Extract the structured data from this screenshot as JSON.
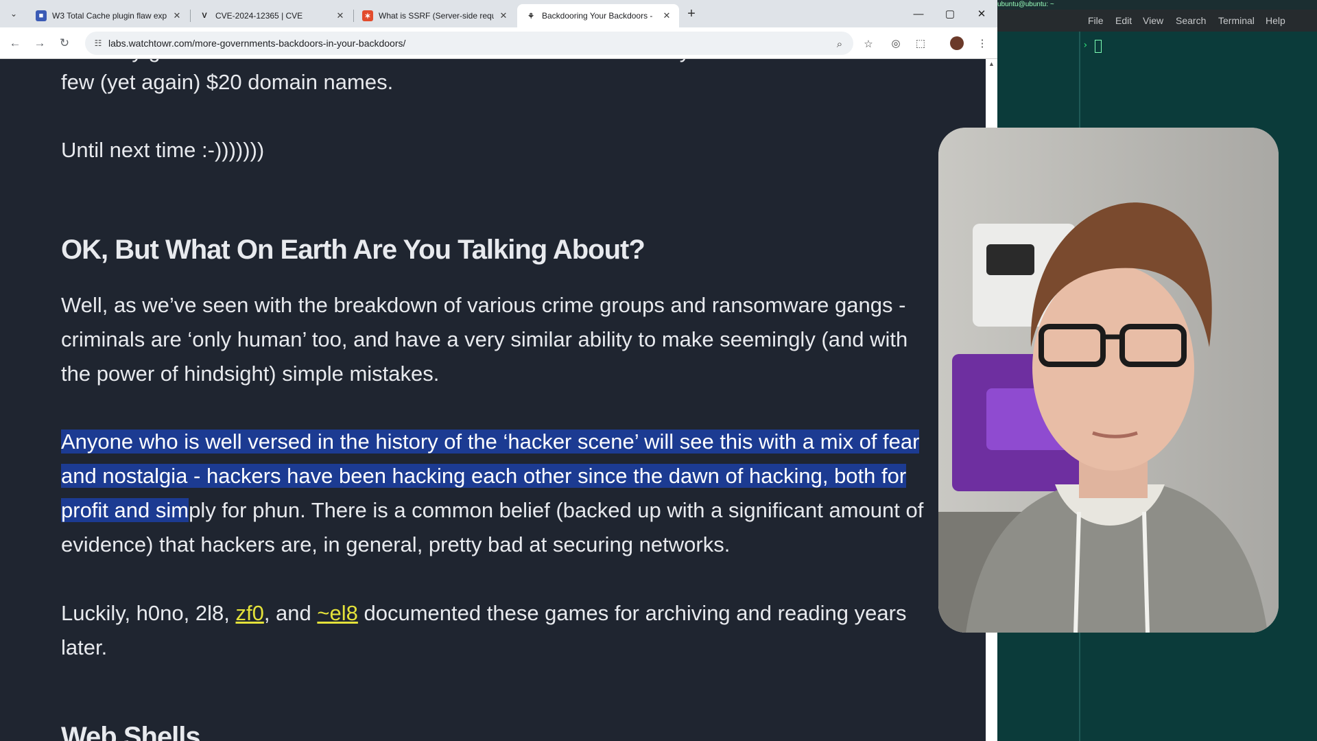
{
  "browser": {
    "tabs": [
      {
        "title": "W3 Total Cache plugin flaw exp",
        "active": false
      },
      {
        "title": "CVE-2024-12365 | CVE",
        "active": false
      },
      {
        "title": "What is SSRF (Server-side requ",
        "active": false
      },
      {
        "title": "Backdooring Your Backdoors - ",
        "active": true
      }
    ],
    "url": "labs.watchtowr.com/more-governments-backdoors-in-your-backdoors/"
  },
  "article": {
    "cut_top_line": "basically give ourselves ‘theoretical’ free access to thousands of systems for the cost of a",
    "para_continued": "few (yet again) $20 domain names.",
    "sign_off": "Until next time :-)))))))",
    "heading_1": "OK, But What On Earth Are You Talking About?",
    "para_1": "Well, as we’ve seen with the breakdown of various crime groups and ransomware gangs - criminals are ‘only human’ too, and have a very similar ability to make seemingly (and with the power of hindsight) simple mistakes.",
    "para_2_highlighted": "Anyone who is well versed in the history of the ‘hacker scene’ will see this with a mix of fear and nostalgia - hackers have been hacking each other since the dawn of hacking, both for profit and sim",
    "para_2_rest": "ply for phun. There is a common belief (backed up with a significant amount of evidence) that hackers are, in general, pretty bad at securing networks.",
    "para_3_start": "Luckily, h0no, 2l8, ",
    "para_3_link1": "zf0",
    "para_3_mid": ", and ",
    "para_3_link2": "~el8",
    "para_3_end": " documented these games for archiving and reading years later.",
    "heading_2": "Web Shells"
  },
  "terminal": {
    "title": "ubuntu@ubuntu: ~",
    "menu": [
      "File",
      "Edit",
      "View",
      "Search",
      "Terminal",
      "Help"
    ],
    "prompt": "›"
  },
  "colors": {
    "page_bg": "#1f2530",
    "text": "#e8eaee",
    "selection": "#1c3b92",
    "link": "#e4e23a",
    "terminal_bg": "#0b3b3a"
  }
}
